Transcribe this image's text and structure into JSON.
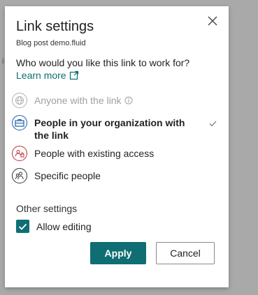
{
  "dialog": {
    "title": "Link settings",
    "filename": "Blog post demo.fluid",
    "question": "Who would you like this link to work for?",
    "learn_more": "Learn more",
    "options": [
      {
        "label": "Anyone with the link",
        "icon": "globe-icon",
        "state": "disabled"
      },
      {
        "label": "People in your organization with the link",
        "icon": "organization-icon",
        "state": "selected"
      },
      {
        "label": "People with existing access",
        "icon": "existing-access-icon",
        "state": "normal"
      },
      {
        "label": "Specific people",
        "icon": "specific-people-icon",
        "state": "normal"
      }
    ],
    "other_settings": "Other settings",
    "allow_editing": {
      "label": "Allow editing",
      "checked": true
    },
    "apply_label": "Apply",
    "cancel_label": "Cancel"
  },
  "colors": {
    "accent": "#0f6e73",
    "org_icon": "#1b5ea8",
    "existing_icon": "#b8323a",
    "overlay": "#a9a9a9"
  }
}
